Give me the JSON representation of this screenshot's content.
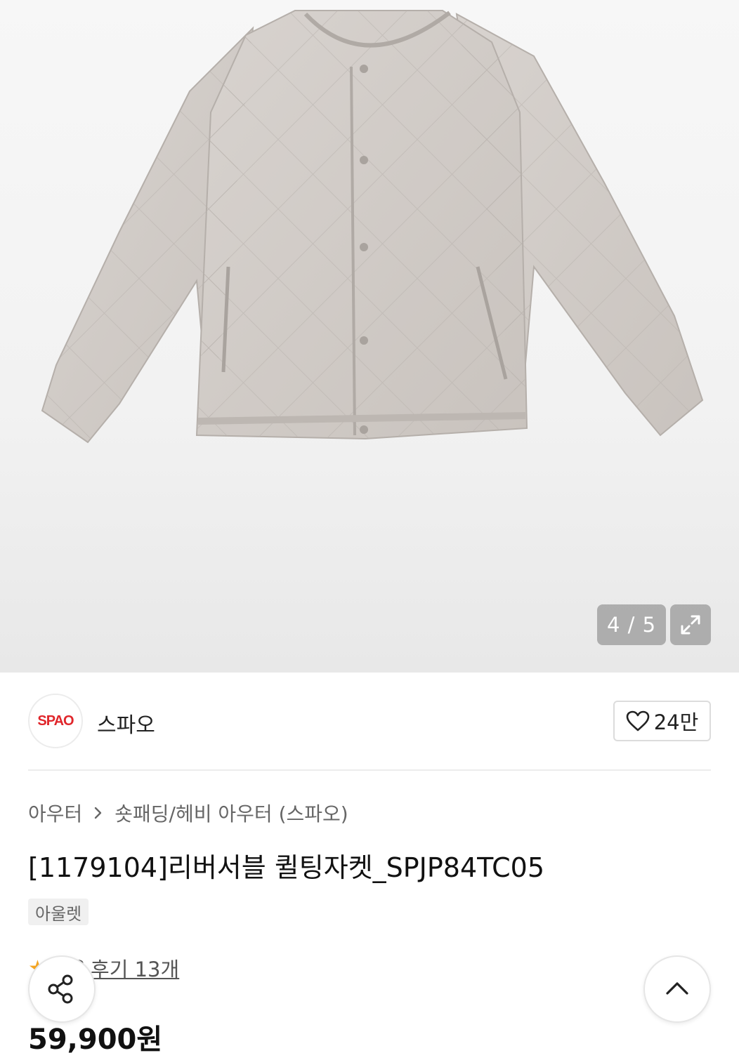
{
  "gallery": {
    "current": "4 / 5",
    "image_alt": "product-jacket"
  },
  "brand": {
    "logo_text": "SPAO",
    "name": "스파오",
    "logo_color": "#e0262b"
  },
  "like": {
    "count": "24만"
  },
  "breadcrumb": {
    "level1": "아우터",
    "level2": "숏패딩/헤비 아우터 (스파오)"
  },
  "product": {
    "title": "[1179104]리버서블 퀼팅자켓_SPJP84TC05",
    "tag": "아울렛",
    "rating": "4.8",
    "review_link": "후기 13개",
    "price": "59,900원"
  },
  "colors": {
    "star": "#f5a623"
  }
}
